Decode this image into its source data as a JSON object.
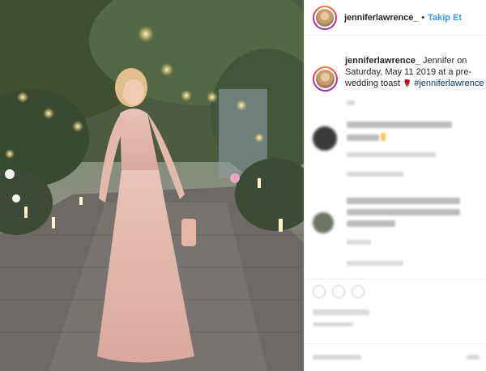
{
  "post": {
    "username": "jenniferlawrence_",
    "separator": "•",
    "follow_label": "Takip Et",
    "caption_user": "jenniferlawrence_",
    "caption_text": "Jennifer on Saturday, May 11 2019 at a pre-wedding toast",
    "caption_emoji": "🌹",
    "caption_tag": "#jenniferlawrence"
  },
  "icons": {
    "like": "heart-icon",
    "comment": "comment-icon",
    "share": "share-icon"
  },
  "colors": {
    "link": "#3897f0",
    "text": "#262626",
    "hashtag": "#00376b"
  }
}
